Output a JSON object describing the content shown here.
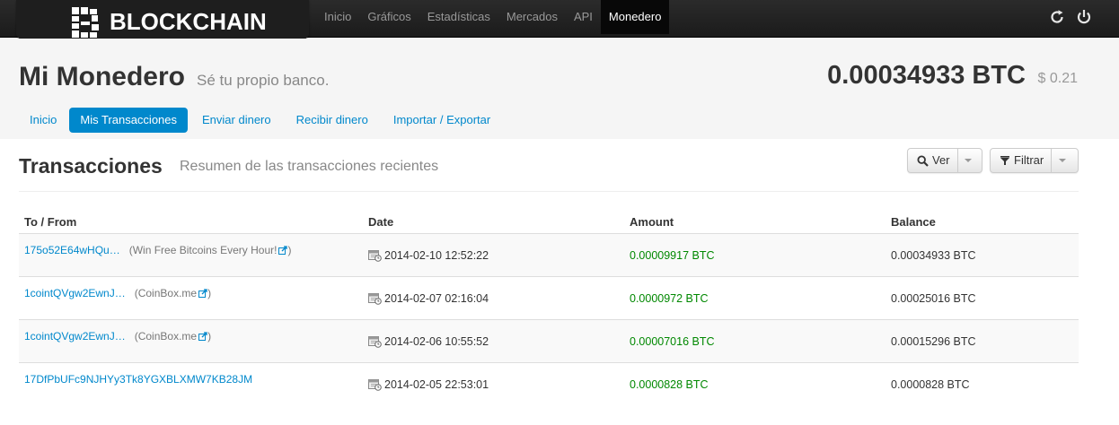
{
  "navbar": {
    "brand": "BLOCKCHAIN",
    "items": [
      {
        "label": "Inicio"
      },
      {
        "label": "Gráficos"
      },
      {
        "label": "Estadísticas"
      },
      {
        "label": "Mercados"
      },
      {
        "label": "API"
      },
      {
        "label": "Monedero",
        "active": true
      }
    ],
    "right_icons": [
      "refresh-icon",
      "power-icon"
    ]
  },
  "header": {
    "title": "Mi Monedero",
    "subtitle": "Sé tu propio banco.",
    "balance": "0.00034933 BTC",
    "balance_usd": "$ 0.21"
  },
  "tabs": [
    {
      "label": "Inicio"
    },
    {
      "label": "Mis Transacciones",
      "active": true
    },
    {
      "label": "Enviar dinero"
    },
    {
      "label": "Recibir dinero"
    },
    {
      "label": "Importar / Exportar"
    }
  ],
  "section": {
    "title": "Transacciones",
    "subtitle": "Resumen de las transacciones recientes",
    "view_button": "Ver",
    "filter_button": "Filtrar"
  },
  "table": {
    "headers": {
      "to_from": "To / From",
      "date": "Date",
      "amount": "Amount",
      "balance": "Balance"
    },
    "rows": [
      {
        "address": "175o52E64wHQu…",
        "note": "(Win Free Bitcoins Every Hour!",
        "note_close": ")",
        "date": "2014-02-10 12:52:22",
        "amount": "0.00009917 BTC",
        "balance": "0.00034933 BTC"
      },
      {
        "address": "1cointQVgw2EwnJ…",
        "note": "(CoinBox.me",
        "note_close": ")",
        "date": "2014-02-07 02:16:04",
        "amount": "0.0000972 BTC",
        "balance": "0.00025016 BTC"
      },
      {
        "address": "1cointQVgw2EwnJ…",
        "note": "(CoinBox.me",
        "note_close": ")",
        "date": "2014-02-06 10:55:52",
        "amount": "0.00007016 BTC",
        "balance": "0.00015296 BTC"
      },
      {
        "address": "17DfPbUFc9NJHYy3Tk8YGXBLXMW7KB28JM",
        "note": "",
        "note_close": "",
        "date": "2014-02-05 22:53:01",
        "amount": "0.0000828 BTC",
        "balance": "0.0000828 BTC"
      }
    ]
  },
  "colors": {
    "link": "#0088cc",
    "amount_positive": "#008800",
    "navbar": "#1b1b1b"
  }
}
